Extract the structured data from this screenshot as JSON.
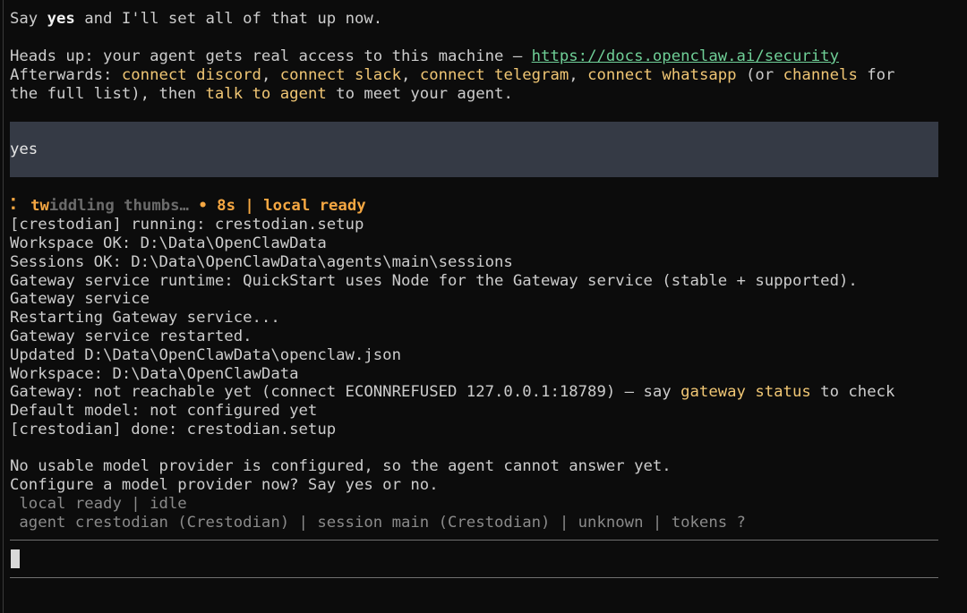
{
  "intro": {
    "line1": {
      "a": "Say ",
      "b": "yes",
      "c": " and I'll set all of that up now."
    },
    "heads": {
      "a": "Heads up: your agent gets real access to this machine — ",
      "link": "https://docs.openclaw.ai/security"
    },
    "after": {
      "a": "Afterwards: ",
      "discord": "connect discord",
      "c1": ", ",
      "slack": "connect slack",
      "c2": ", ",
      "telegram": "connect telegram",
      "c3": ", ",
      "whatsapp": "connect whatsapp",
      "c4": " (or ",
      "channels": "channels",
      "c5": " for"
    },
    "after2": {
      "a": "the full list), then ",
      "talk": "talk to agent",
      "b": " to meet your agent."
    }
  },
  "user_input": "yes",
  "status": {
    "spinner": "⠅",
    "tw": "tw",
    "rest": "iddling thumbs…",
    "meta": " • 8s | local ready"
  },
  "log": [
    "[crestodian] running: crestodian.setup",
    "Workspace OK: D:\\Data\\OpenClawData",
    "Sessions OK: D:\\Data\\OpenClawData\\agents\\main\\sessions",
    "Gateway service runtime: QuickStart uses Node for the Gateway service (stable + supported).",
    "Gateway service",
    "Restarting Gateway service...",
    "Gateway service restarted.",
    "Updated D:\\Data\\OpenClawData\\openclaw.json",
    "Workspace: D:\\Data\\OpenClawData"
  ],
  "gateway_line": {
    "a": "Gateway: not reachable yet (connect ECONNREFUSED 127.0.0.1:18789) — say ",
    "cmd": "gateway status",
    "b": " to check"
  },
  "log2": [
    "Default model: not configured yet",
    "[crestodian] done: crestodian.setup"
  ],
  "notice": [
    "No usable model provider is configured, so the agent cannot answer yet.",
    "Configure a model provider now? Say yes or no."
  ],
  "footer": {
    "line1": " local ready | idle",
    "line2": " agent crestodian (Crestodian) | session main (Crestodian) | unknown | tokens ?"
  }
}
